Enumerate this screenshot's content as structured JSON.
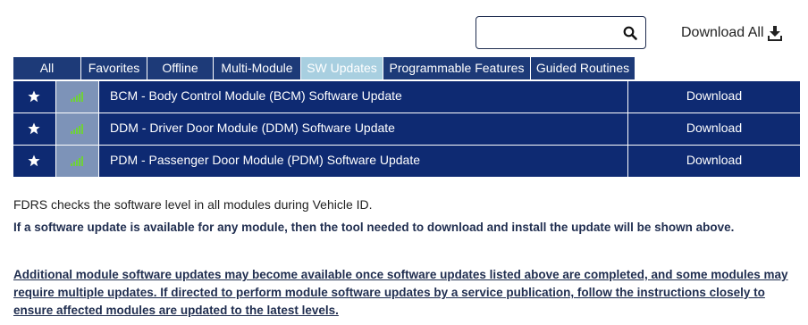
{
  "search": {
    "value": "",
    "placeholder": "",
    "icon": "search-icon"
  },
  "download_all": {
    "label": "Download All",
    "icon": "download-icon"
  },
  "tabs": [
    {
      "label": "All"
    },
    {
      "label": "Favorites"
    },
    {
      "label": "Offline"
    },
    {
      "label": "Multi-Module"
    },
    {
      "label": "SW Updates",
      "active": true
    },
    {
      "label": "Programmable Features"
    },
    {
      "label": "Guided Routines"
    }
  ],
  "rows": [
    {
      "title": "BCM - Body Control Module (BCM) Software Update",
      "action": "Download"
    },
    {
      "title": "DDM - Driver Door Module (DDM) Software Update",
      "action": "Download"
    },
    {
      "title": "PDM - Passenger Door Module (PDM) Software Update",
      "action": "Download"
    }
  ],
  "info": {
    "line1": "FDRS checks the software level in all modules during Vehicle ID.",
    "line2": "If a software update is available for any module, then the tool needed to download and install the update will be shown above.",
    "line3": "Additional module software updates may become available once software updates listed above are completed, and some modules may require multiple updates. If directed to perform module software updates by a service publication, follow the instructions closely to ensure affected modules are updated to the latest levels."
  },
  "colors": {
    "row_bg": "#0e2a72",
    "tab_bg": "#1d3a78",
    "tab_active_bg": "#a8cfe0",
    "signal_green": "#6fd13a"
  }
}
